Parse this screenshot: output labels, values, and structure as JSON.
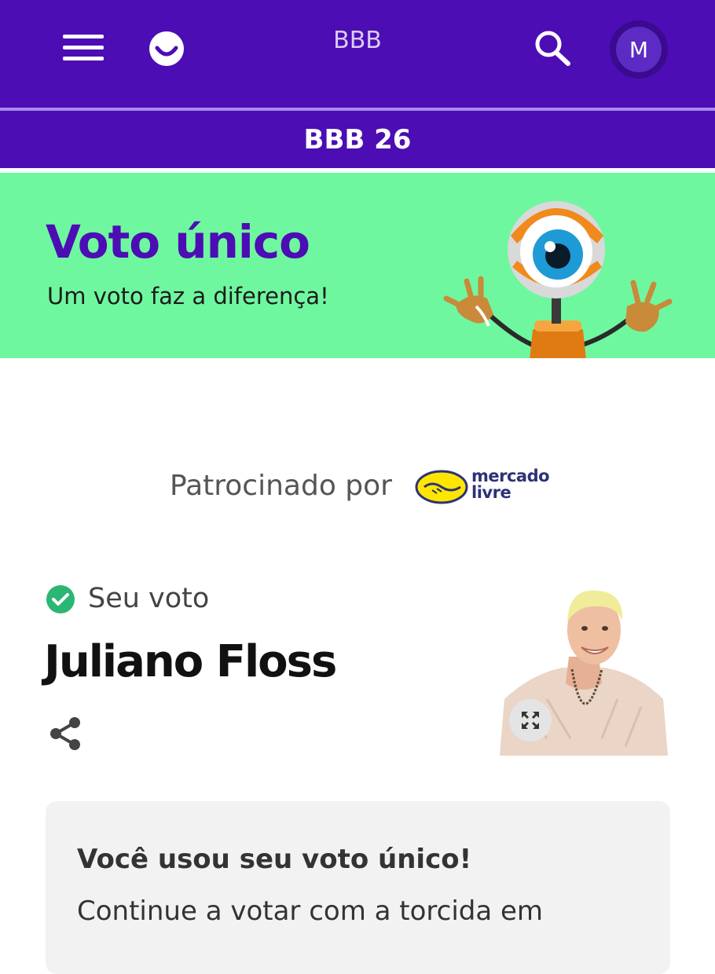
{
  "header": {
    "brand": "BBB",
    "avatar_initial": "M",
    "menu_icon": "hamburger-icon",
    "logo_icon": "globoplay-smile-logo",
    "search_icon": "search-icon",
    "background_color": "#4c0db4"
  },
  "subheader": {
    "title": "BBB 26"
  },
  "banner": {
    "title": "Voto único",
    "subtitle": "Um voto faz a diferença!",
    "background_color": "#6ff79f",
    "title_color": "#4c0db4",
    "mascot": "big-brother-eye-mascot"
  },
  "sponsor": {
    "label": "Patrocinado por",
    "brand_line1": "mercado",
    "brand_line2": "livre"
  },
  "vote": {
    "status_label": "Seu voto",
    "status_icon": "check-circle-icon",
    "status_color": "#2bb673",
    "candidate_name": "Juliano Floss",
    "share_icon": "share-icon",
    "expand_icon": "expand-icon"
  },
  "info_card": {
    "title": "Você usou seu voto único!",
    "text": "Continue a votar com a torcida em"
  }
}
